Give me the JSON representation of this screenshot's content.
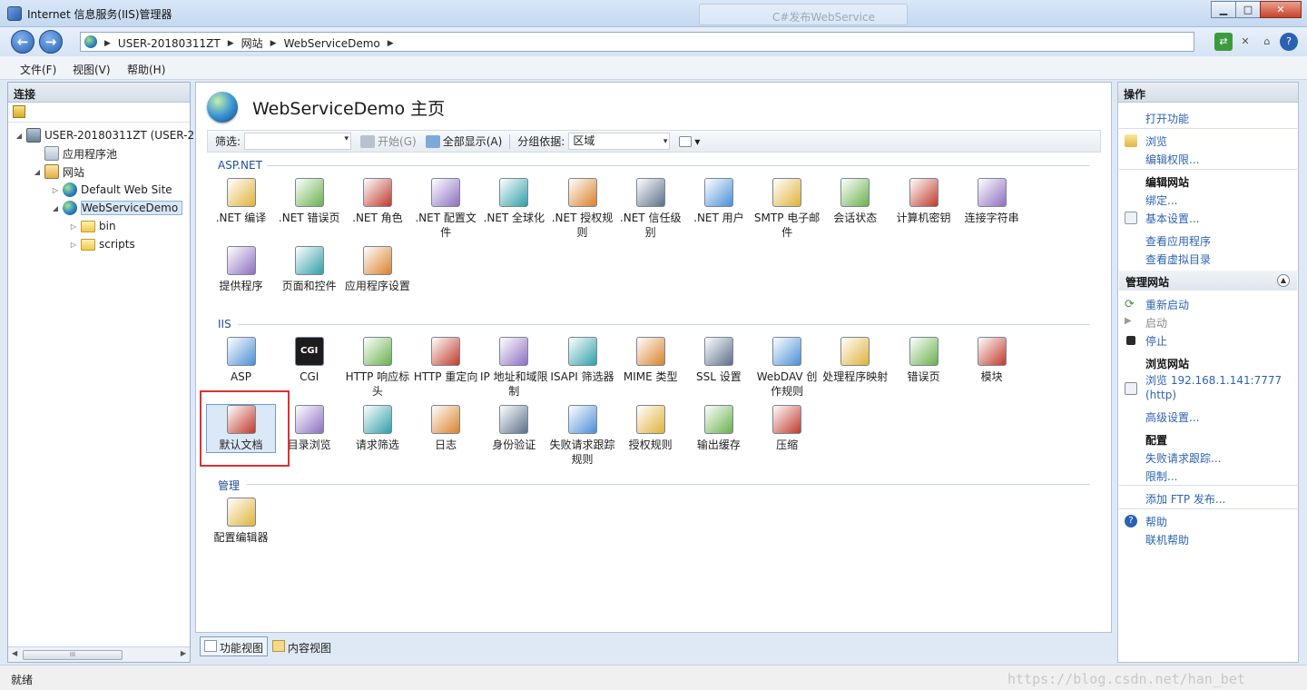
{
  "window": {
    "title": "Internet 信息服务(IIS)管理器",
    "ghost_tab": "C#发布WebService"
  },
  "address": {
    "crumbs": [
      "USER-20180311ZT",
      "网站",
      "WebServiceDemo"
    ]
  },
  "menu": {
    "file": "文件(F)",
    "view": "视图(V)",
    "help": "帮助(H)"
  },
  "connections": {
    "header": "连接",
    "tree": [
      {
        "label": "USER-20180311ZT (USER-2",
        "icon": "server-icon",
        "expand": "◢"
      },
      {
        "label": "应用程序池",
        "icon": "app-pool-icon",
        "expand": ""
      },
      {
        "label": "网站",
        "icon": "sites-icon",
        "expand": "◢"
      },
      {
        "label": "Default Web Site",
        "icon": "globe-icon",
        "expand": "▷"
      },
      {
        "label": "WebServiceDemo",
        "icon": "globe-icon",
        "expand": "◢"
      },
      {
        "label": "bin",
        "icon": "folder-icon",
        "expand": "▷"
      },
      {
        "label": "scripts",
        "icon": "folder-icon",
        "expand": "▷"
      }
    ],
    "scroll_thumb": "III"
  },
  "center": {
    "title": "WebServiceDemo 主页",
    "filter": {
      "label": "筛选:",
      "start": "开始(G)",
      "show_all": "全部显示(A)",
      "group_by": "分组依据:",
      "group_value": "区域"
    },
    "groups": {
      "aspnet": "ASP.NET",
      "iis": "IIS",
      "mgmt": "管理"
    },
    "aspnet_row1": [
      {
        "label": ".NET 编译",
        "icon": "compile-icon"
      },
      {
        "label": ".NET 错误页",
        "icon": "error-page-icon"
      },
      {
        "label": ".NET 角色",
        "icon": "roles-icon"
      },
      {
        "label": ".NET 配置文件",
        "icon": "profile-icon"
      },
      {
        "label": ".NET 全球化",
        "icon": "globalization-icon"
      },
      {
        "label": ".NET 授权规则",
        "icon": "authorization-icon"
      },
      {
        "label": ".NET 信任级别",
        "icon": "trust-icon"
      },
      {
        "label": ".NET 用户",
        "icon": "users-icon"
      },
      {
        "label": "SMTP 电子邮件",
        "icon": "smtp-icon"
      },
      {
        "label": "会话状态",
        "icon": "session-icon"
      },
      {
        "label": "计算机密钥",
        "icon": "machine-key-icon"
      },
      {
        "label": "连接字符串",
        "icon": "connection-string-icon"
      }
    ],
    "aspnet_row2": [
      {
        "label": "提供程序",
        "icon": "providers-icon"
      },
      {
        "label": "页面和控件",
        "icon": "pages-controls-icon"
      },
      {
        "label": "应用程序设置",
        "icon": "app-settings-icon"
      }
    ],
    "iis_row1": [
      {
        "label": "ASP",
        "icon": "asp-icon"
      },
      {
        "label": "CGI",
        "icon": "cgi-icon"
      },
      {
        "label": "HTTP 响应标头",
        "icon": "http-headers-icon"
      },
      {
        "label": "HTTP 重定向",
        "icon": "redirect-icon"
      },
      {
        "label": "IP 地址和域限制",
        "icon": "ip-restrictions-icon"
      },
      {
        "label": "ISAPI 筛选器",
        "icon": "isapi-filters-icon"
      },
      {
        "label": "MIME 类型",
        "icon": "mime-icon"
      },
      {
        "label": "SSL 设置",
        "icon": "ssl-icon"
      },
      {
        "label": "WebDAV 创作规则",
        "icon": "webdav-icon"
      },
      {
        "label": "处理程序映射",
        "icon": "handler-mappings-icon"
      },
      {
        "label": "错误页",
        "icon": "error-pages-icon"
      },
      {
        "label": "模块",
        "icon": "modules-icon"
      }
    ],
    "iis_row2": [
      {
        "label": "默认文档",
        "icon": "default-document-icon"
      },
      {
        "label": "目录浏览",
        "icon": "directory-browsing-icon"
      },
      {
        "label": "请求筛选",
        "icon": "request-filtering-icon"
      },
      {
        "label": "日志",
        "icon": "logging-icon"
      },
      {
        "label": "身份验证",
        "icon": "authentication-icon"
      },
      {
        "label": "失败请求跟踪规则",
        "icon": "failed-request-icon"
      },
      {
        "label": "授权规则",
        "icon": "authorization-rules-icon"
      },
      {
        "label": "输出缓存",
        "icon": "output-cache-icon"
      },
      {
        "label": "压缩",
        "icon": "compression-icon"
      }
    ],
    "mgmt_row": [
      {
        "label": "配置编辑器",
        "icon": "config-editor-icon"
      }
    ],
    "tabs": {
      "features": "功能视图",
      "content": "内容视图"
    }
  },
  "actions": {
    "header": "操作",
    "open_feature": "打开功能",
    "explore": "浏览",
    "edit_permissions": "编辑权限...",
    "edit_site": "编辑网站",
    "bindings": "绑定...",
    "basic_settings": "基本设置...",
    "view_applications": "查看应用程序",
    "view_vdirs": "查看虚拟目录",
    "manage_site": "管理网站",
    "restart": "重新启动",
    "start": "启动",
    "stop": "停止",
    "browse_site": "浏览网站",
    "browse_link": "浏览 192.168.1.141:7777",
    "browse_proto": "(http)",
    "advanced": "高级设置...",
    "configure": "配置",
    "failed_tracing": "失败请求跟踪...",
    "limits": "限制...",
    "add_ftp": "添加 FTP 发布...",
    "help": "帮助",
    "online_help": "联机帮助"
  },
  "status": {
    "text": "就绪",
    "watermark": "https://blog.csdn.net/han_bet"
  }
}
